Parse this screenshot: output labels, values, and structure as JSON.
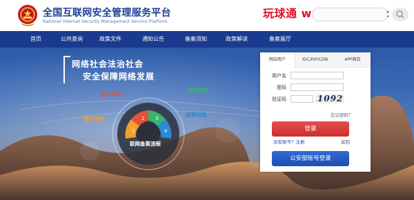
{
  "header": {
    "title": "全国互联网安全管理服务平台",
    "subtitle": "National Internet Security Management Service Platform",
    "watermark": "玩球通 wanqiutong.c"
  },
  "nav": {
    "items": [
      {
        "label": "首页"
      },
      {
        "label": "公共查询"
      },
      {
        "label": "政策文件"
      },
      {
        "label": "通知公告"
      },
      {
        "label": "备案须知"
      },
      {
        "label": "政策解读"
      },
      {
        "label": "备案展厅"
      }
    ]
  },
  "banner": {
    "slogan_line1": "网络社会法治社会",
    "slogan_line2": "安全保障网络发展",
    "flow": {
      "center": "联网备案流程",
      "steps": [
        "提交申请",
        "初步审核",
        "预约检查",
        "备案完成"
      ],
      "numbers": [
        "1",
        "2",
        "3",
        "4"
      ]
    }
  },
  "login": {
    "tabs": [
      {
        "label": "网站用户"
      },
      {
        "label": "IDC/ISP/CDN"
      },
      {
        "label": "APP商店"
      }
    ],
    "username_label": "用户名",
    "password_label": "密码",
    "captcha_label": "验证码",
    "captcha_code": "1092",
    "forgot_password": "忘记密码？",
    "login_button": "登录",
    "register_link": "没有账号？注册",
    "back_link": "返回",
    "gongan_button": "公安部账号登录"
  },
  "colors": {
    "nav_bg": "#1a3a8f",
    "title": "#1c3f94",
    "login_btn": "#d53434",
    "gongan_btn": "#2458c0",
    "watermark": "#e0122a"
  }
}
